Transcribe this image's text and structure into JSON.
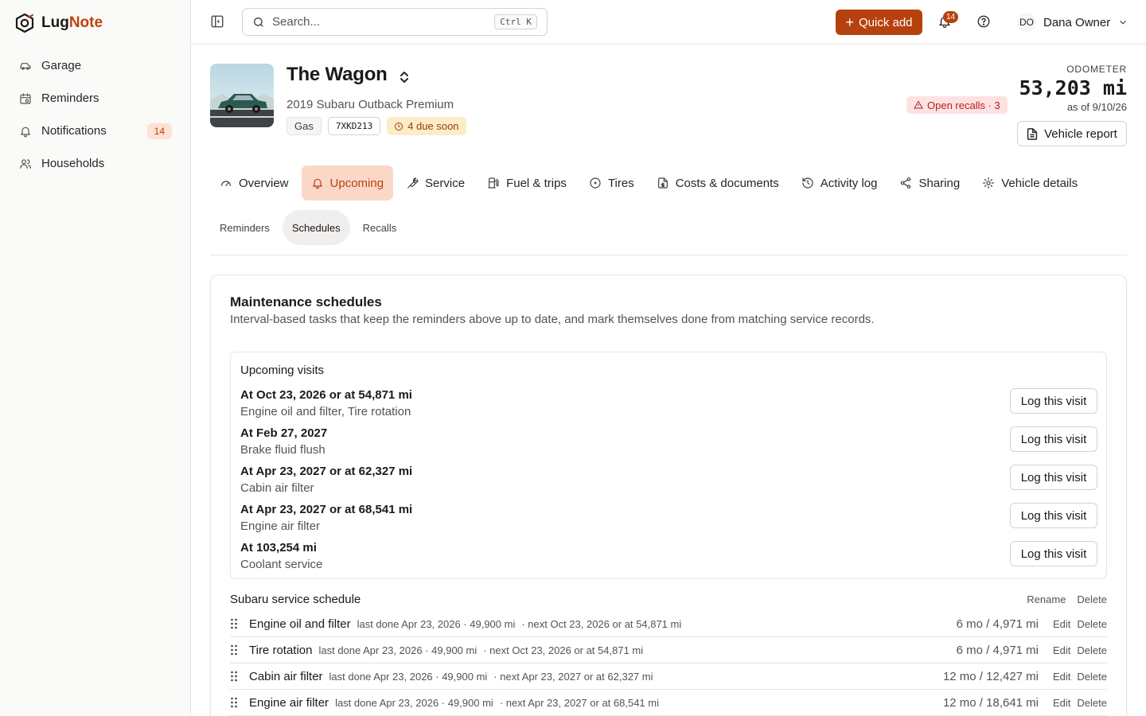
{
  "app": {
    "name_part1": "Lug",
    "name_part2": "Note"
  },
  "sidebar": {
    "items": [
      {
        "label": "Garage",
        "icon": "car-icon"
      },
      {
        "label": "Reminders",
        "icon": "calendar-clock-icon"
      },
      {
        "label": "Notifications",
        "icon": "bell-icon",
        "badge": "14"
      },
      {
        "label": "Households",
        "icon": "users-icon"
      }
    ]
  },
  "topbar": {
    "search_placeholder": "Search...",
    "search_shortcut": "Ctrl K",
    "quick_add_label": "Quick add",
    "notifications_count": "14",
    "user_initials": "DO",
    "user_name": "Dana Owner"
  },
  "vehicle": {
    "name": "The Wagon",
    "subtitle": "2019 Subaru Outback Premium",
    "fuel": "Gas",
    "plate": "7XKD213",
    "due_soon": "4 due soon",
    "recalls": "Open recalls · 3",
    "odometer_label": "ODOMETER",
    "odometer_value": "53,203 mi",
    "odometer_date": "as of 9/10/26",
    "report_label": "Vehicle report"
  },
  "tabs": [
    {
      "label": "Overview",
      "icon": "gauge-icon",
      "active": false
    },
    {
      "label": "Upcoming",
      "icon": "bell-icon",
      "active": true
    },
    {
      "label": "Service",
      "icon": "wrench-icon",
      "active": false
    },
    {
      "label": "Fuel & trips",
      "icon": "fuel-icon",
      "active": false
    },
    {
      "label": "Tires",
      "icon": "circle-icon",
      "active": false
    },
    {
      "label": "Costs & documents",
      "icon": "file-dollar-icon",
      "active": false
    },
    {
      "label": "Activity log",
      "icon": "history-icon",
      "active": false
    },
    {
      "label": "Sharing",
      "icon": "share-icon",
      "active": false
    },
    {
      "label": "Vehicle details",
      "icon": "settings-icon",
      "active": false
    }
  ],
  "subtabs": [
    {
      "label": "Reminders",
      "active": false
    },
    {
      "label": "Schedules",
      "active": true
    },
    {
      "label": "Recalls",
      "active": false
    }
  ],
  "schedules": {
    "title": "Maintenance schedules",
    "description": "Interval-based tasks that keep the reminders above up to date, and mark themselves done from matching service records.",
    "visits_title": "Upcoming visits",
    "log_label": "Log this visit",
    "visits": [
      {
        "when": "At Oct 23, 2026 or at 54,871 mi",
        "what": "Engine oil and filter, Tire rotation"
      },
      {
        "when": "At Feb 27, 2027",
        "what": "Brake fluid flush"
      },
      {
        "when": "At Apr 23, 2027 or at 62,327 mi",
        "what": "Cabin air filter"
      },
      {
        "when": "At Apr 23, 2027 or at 68,541 mi",
        "what": "Engine air filter"
      },
      {
        "when": "At 103,254 mi",
        "what": "Coolant service"
      }
    ],
    "schedule_name": "Subaru service schedule",
    "rename_label": "Rename",
    "delete_label": "Delete",
    "edit_label": "Edit",
    "tasks": [
      {
        "name": "Engine oil and filter",
        "last": "last done Apr 23, 2026 · 49,900 mi",
        "next": "· next Oct 23, 2026 or at 54,871 mi",
        "interval": "6 mo / 4,971 mi"
      },
      {
        "name": "Tire rotation",
        "last": "last done Apr 23, 2026 · 49,900 mi",
        "next": "· next Oct 23, 2026 or at 54,871 mi",
        "interval": "6 mo / 4,971 mi"
      },
      {
        "name": "Cabin air filter",
        "last": "last done Apr 23, 2026 · 49,900 mi",
        "next": "· next Apr 23, 2027 or at 62,327 mi",
        "interval": "12 mo / 12,427 mi"
      },
      {
        "name": "Engine air filter",
        "last": "last done Apr 23, 2026 · 49,900 mi",
        "next": "· next Apr 23, 2027 or at 68,541 mi",
        "interval": "12 mo / 18,641 mi"
      }
    ]
  },
  "colors": {
    "accent": "#b7410e",
    "accent_soft": "#fbd7c8",
    "danger_soft": "#fde2e2",
    "warning_soft": "#fdecc8"
  }
}
